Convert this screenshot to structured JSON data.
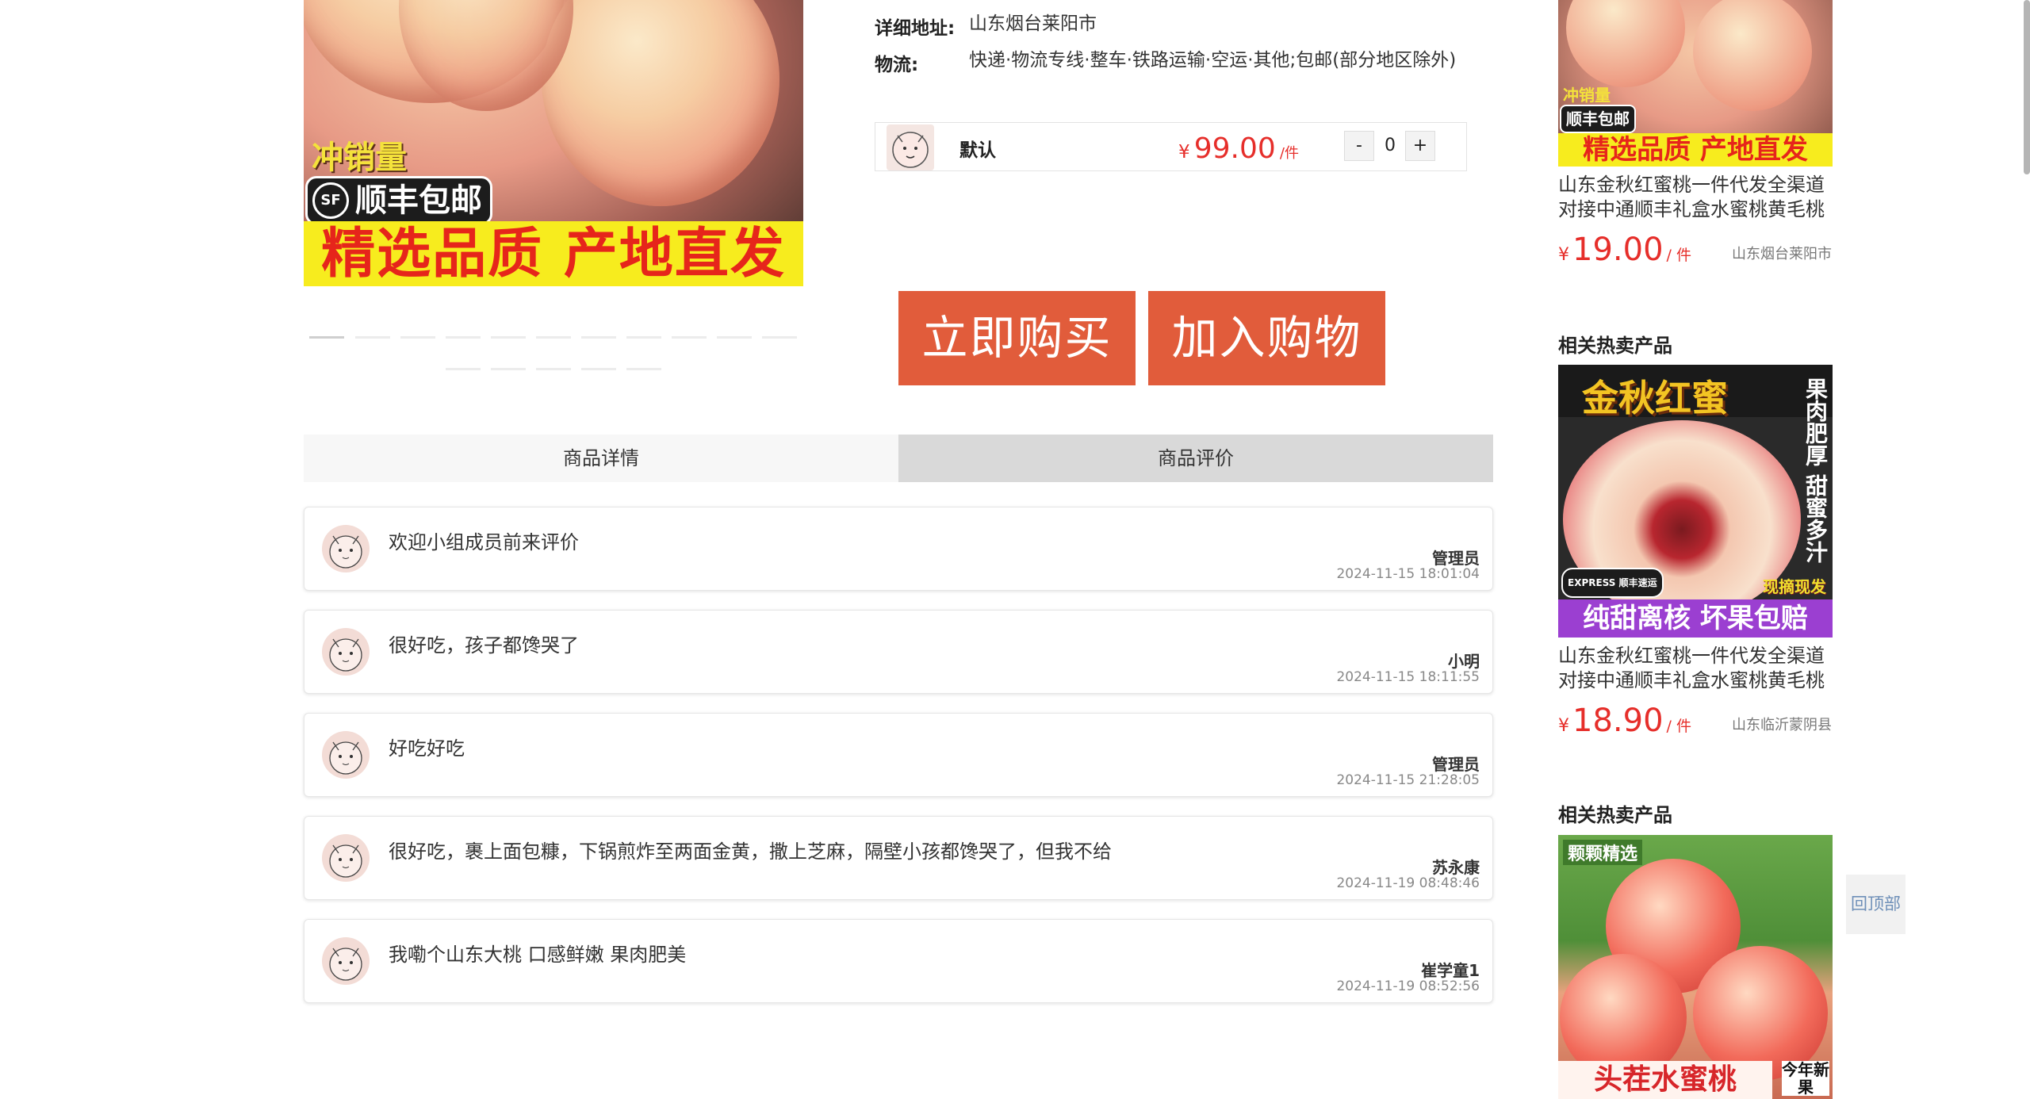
{
  "product_image": {
    "tag_sales": "冲销量",
    "tag_shipping": "顺丰包邮",
    "sf_logo": "SF",
    "banner": "精选品质 产地直发"
  },
  "info": {
    "address_label": "详细地址:",
    "address_value": "山东烟台莱阳市",
    "logistics_label": "物流:",
    "logistics_value": "快递·物流专线·整车·铁路运输·空运·其他;包邮(部分地区除外)"
  },
  "sku": {
    "name": "默认",
    "currency": "¥",
    "price": "99.00",
    "unit": "/件",
    "minus": "-",
    "qty": "0",
    "plus": "+"
  },
  "actions": {
    "buy_now": "立即购买",
    "add_cart": "加入购物车"
  },
  "tabs": {
    "details": "商品详情",
    "reviews": "商品评价"
  },
  "reviews": [
    {
      "text": "欢迎小组成员前来评价",
      "user": "管理员",
      "time": "2024-11-15 18:01:04"
    },
    {
      "text": "很好吃，孩子都馋哭了",
      "user": "小明",
      "time": "2024-11-15 18:11:55"
    },
    {
      "text": "好吃好吃",
      "user": "管理员",
      "time": "2024-11-15 21:28:05"
    },
    {
      "text": "很好吃，裹上面包糠，下锅煎炸至两面金黄，撒上芝麻，隔壁小孩都馋哭了，但我不给",
      "user": "苏永康",
      "time": "2024-11-19 08:48:46"
    },
    {
      "text": "我嘞个山东大桃 口感鲜嫩 果肉肥美",
      "user": "崔学童1",
      "time": "2024-11-19 08:52:56"
    }
  ],
  "sidebar": {
    "section_title": "相关热卖产品",
    "products": [
      {
        "img_tag_sales": "冲销量",
        "img_tag_shipping": "顺丰包邮",
        "img_banner": "精选品质 产地直发",
        "name": "山东金秋红蜜桃一件代发全渠道对接中通顺丰礼盒水蜜桃黄毛桃",
        "currency": "¥",
        "price": "19.00",
        "unit": "/ 件",
        "location": "山东烟台莱阳市"
      },
      {
        "img_title": "金秋红蜜",
        "img_side_text": "果肉肥厚 甜蜜多汁",
        "img_express": "EXPRESS 顺丰速运",
        "img_badge": "现摘现发",
        "img_banner": "纯甜离核 坏果包赔",
        "name": "山东金秋红蜜桃一件代发全渠道对接中通顺丰礼盒水蜜桃黄毛桃",
        "currency": "¥",
        "price": "18.90",
        "unit": "/ 件",
        "location": "山东临沂蒙阴县"
      },
      {
        "img_tag": "颗颗精选",
        "img_banner": "头茬水蜜桃",
        "img_badge": "今年新果"
      }
    ]
  },
  "back_to_top": "回顶部",
  "colors": {
    "accent": "#e15c3b",
    "price": "#e62e2a",
    "banner_yellow": "#f7ec1e",
    "banner_purple": "#9b3fd1"
  }
}
